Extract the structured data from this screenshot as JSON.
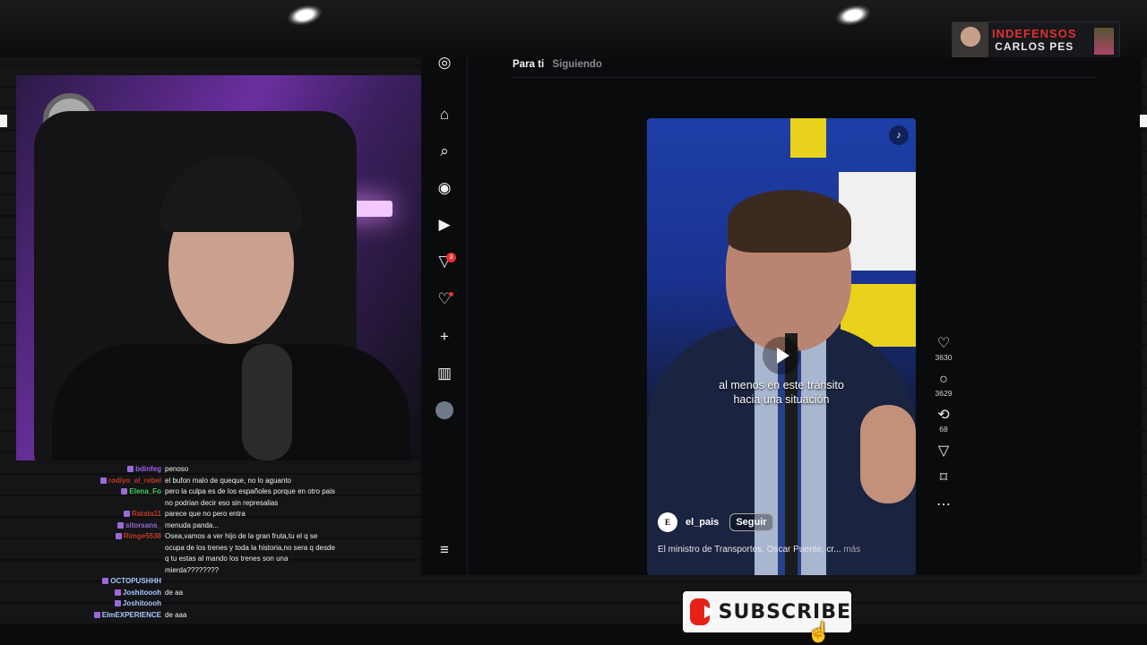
{
  "overlay": {
    "brand_line1": "INDEFENSOS",
    "brand_line2": "CARLOS PES",
    "subscribe_label": "SUBSCRIBE"
  },
  "feed": {
    "tabs": [
      {
        "label": "Para ti",
        "active": true
      },
      {
        "label": "Siguiendo",
        "active": false
      }
    ],
    "notification_count": "3"
  },
  "video": {
    "subtitle_line1": "al menos en este tránsito",
    "subtitle_line2": "hacia una situación",
    "account_logo": "E",
    "account_name": "el_pais",
    "follow_label": "Seguir",
    "caption": "El ministro de Transportes, Óscar Puente, cr... ",
    "more_label": "más"
  },
  "actions": {
    "likes": "3630",
    "comments": "3629",
    "reposts": "68"
  },
  "chat": [
    {
      "user": "bdinfeg",
      "color": "#9d5cf0",
      "message": "penoso"
    },
    {
      "user": "rodiyo_el_rebel",
      "color": "#c0392b",
      "message": "el bufon malo de queque, no lo aguanto"
    },
    {
      "user": "Elena_Fo",
      "color": "#3ecf5a",
      "message": "pero la culpa es de los españoles porque en otro pais no podrian decir eso sin represalias"
    },
    {
      "user": "Ratata11",
      "color": "#c0392b",
      "message": "parece que no pero entra"
    },
    {
      "user": "sitorsans_",
      "color": "#9b6ad6",
      "message": "menuda panda..."
    },
    {
      "user": "Rimge5538",
      "color": "#c0392b",
      "message": "Osea,vamos a ver hijo de la gran fruta,tu el q se ocupa de los trenes y toda la historia,no sera q desde q tu estas al mando los trenes son una mierda????????"
    },
    {
      "user": "OCTOPUSHHH",
      "color": "#a8c8ff",
      "message": ""
    },
    {
      "user": "Joshitoooh",
      "color": "#a8c8ff",
      "message": "de aa"
    },
    {
      "user": "Joshitoooh",
      "color": "#a8c8ff",
      "message": ""
    },
    {
      "user": "ElmEXPERIENCE",
      "color": "#a8c8ff",
      "message": "de aaa"
    }
  ]
}
